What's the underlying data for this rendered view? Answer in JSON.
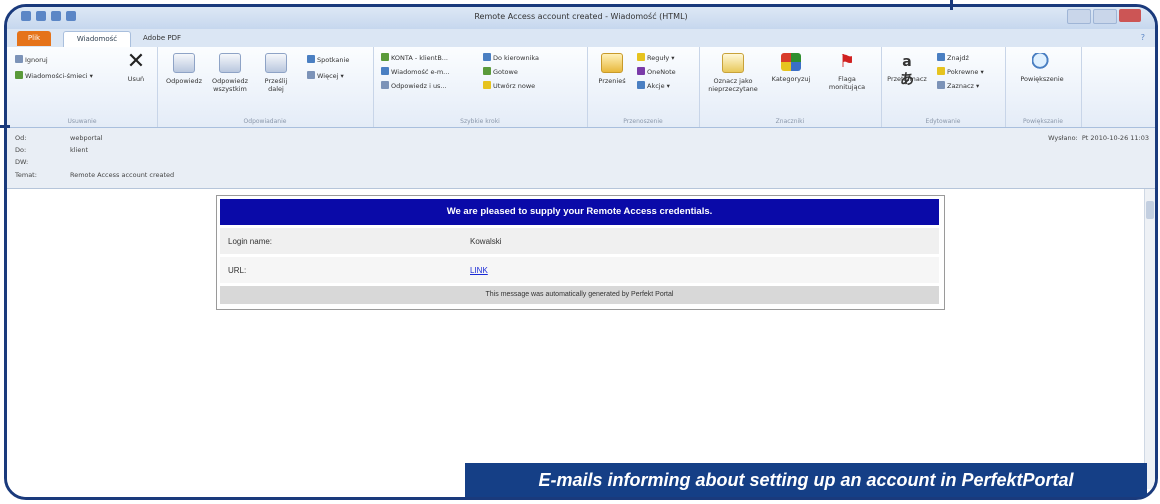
{
  "window": {
    "title": "Remote Access account created - Wiadomość (HTML)"
  },
  "ribbon": {
    "tabs": [
      "Plik",
      "Wiadomość",
      "Adobe PDF"
    ],
    "groups": [
      {
        "label": "Usuwanie"
      },
      {
        "label": "Odpowiadanie"
      },
      {
        "label": "Szybkie kroki"
      },
      {
        "label": "Przenoszenie"
      },
      {
        "label": "Znaczniki"
      },
      {
        "label": "Edytowanie"
      },
      {
        "label": "Powiększanie"
      }
    ],
    "buttons": {
      "ignore": "Ignoruj",
      "junk": "Wiadomości-śmieci",
      "delete": "Usuń",
      "reply": "Odpowiedz",
      "reply_all": "Odpowiedz wszystkim",
      "forward": "Prześlij dalej",
      "meeting": "Spotkanie",
      "more": "Więcej",
      "qs1": "KONTA - klientB...",
      "qs2": "Wiadomość e-m...",
      "qs3": "Odpowiedz i us...",
      "qs4": "Do kierownika",
      "qs5": "Gotowe",
      "qs6": "Utwórz nowe",
      "move": "Przenieś",
      "rules": "Reguły",
      "onenote": "OneNote",
      "actions": "Akcje",
      "mark_unread": "Oznacz jako nieprzeczytane",
      "categorize": "Kategoryzuj",
      "followup": "Flaga monitująca",
      "translate": "Przetłumacz",
      "find": "Znajdź",
      "related": "Pokrewne",
      "select": "Zaznacz",
      "zoom": "Powiększenie"
    }
  },
  "header": {
    "from_label": "Od:",
    "from_value": "webportal",
    "to_label": "Do:",
    "to_value": "klient",
    "cc_label": "DW:",
    "subject_label": "Temat:",
    "subject_value": "Remote Access account created",
    "sent_label": "Wysłano:",
    "sent_value": "Pt 2010-10-26 11:03"
  },
  "email": {
    "heading": "We are pleased to supply your Remote Access credentials.",
    "rows": [
      {
        "label": "Login name:",
        "value": "Kowalski"
      },
      {
        "label": "URL:",
        "value": "LINK"
      }
    ],
    "footer": "This message was automatically generated by Perfekt Portal"
  },
  "caption": "E-mails informing about setting up an account in PerfektPortal",
  "colors": {
    "brand_blue": "#153f86",
    "email_header": "#0a0aa8",
    "link": "#1a2ad6",
    "file_tab": "#e5731a"
  }
}
